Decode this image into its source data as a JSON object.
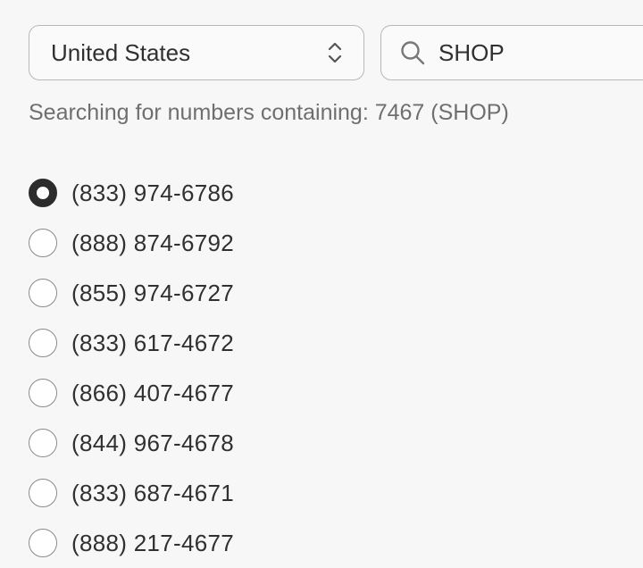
{
  "country_select": {
    "value": "United States",
    "icon": "chevron-up-down-icon"
  },
  "search": {
    "value": "SHOP",
    "icon": "search-icon"
  },
  "hint_text": "Searching for numbers containing: 7467 (SHOP)",
  "numbers": [
    {
      "label": "(833) 974-6786",
      "selected": true
    },
    {
      "label": "(888) 874-6792",
      "selected": false
    },
    {
      "label": "(855) 974-6727",
      "selected": false
    },
    {
      "label": "(833) 617-4672",
      "selected": false
    },
    {
      "label": "(866) 407-4677",
      "selected": false
    },
    {
      "label": "(844) 967-4678",
      "selected": false
    },
    {
      "label": "(833) 687-4671",
      "selected": false
    },
    {
      "label": "(888) 217-4677",
      "selected": false
    }
  ]
}
